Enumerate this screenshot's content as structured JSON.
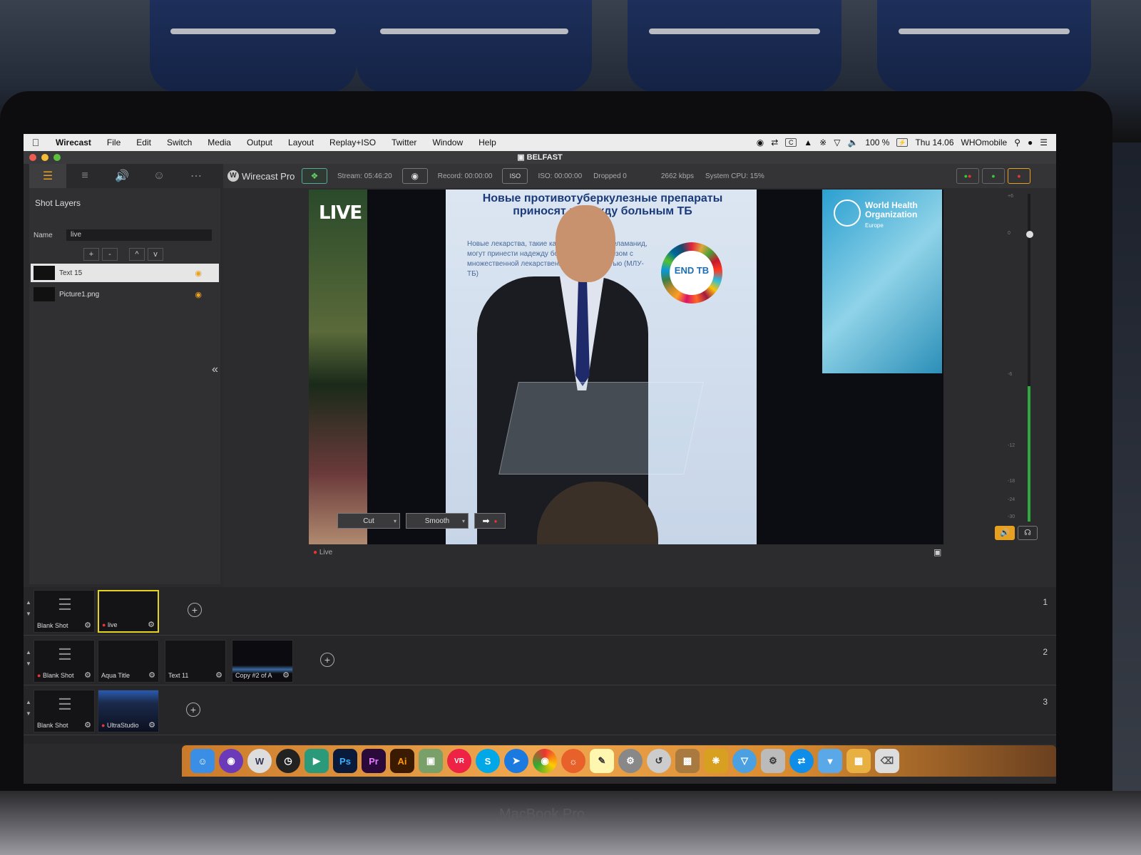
{
  "menubar": {
    "app_name": "Wirecast",
    "items": [
      "File",
      "Edit",
      "Switch",
      "Media",
      "Output",
      "Layout",
      "Replay+ISO",
      "Twitter",
      "Window",
      "Help"
    ],
    "battery": "100 %",
    "clock": "Thu 14.06",
    "user": "WHOmobile"
  },
  "window": {
    "title": "BELFAST"
  },
  "left_panel": {
    "title": "Shot Layers",
    "name_label": "Name",
    "name_value": "live",
    "buttons": [
      "+",
      "-",
      "^",
      "v"
    ],
    "layers": [
      {
        "name": "Text 15",
        "selected": true
      },
      {
        "name": "Picture1.png",
        "selected": false
      }
    ]
  },
  "toolbar": {
    "product": "Wirecast Pro",
    "stream": "Stream: 05:46:20",
    "record": "Record: 00:00:00",
    "iso_button": "ISO",
    "iso": "ISO: 00:00:00",
    "dropped": "Dropped 0",
    "bitrate": "2662 kbps",
    "cpu": "System CPU: 15%"
  },
  "preview": {
    "live_overlay": "LIVE",
    "banner_headline": "Новые противотуберкулезные препараты приносят надежду больным ТБ",
    "banner_body": "Новые лекарства, такие как бедаквилин и деламанид, могут принести надежду больным туберкулезом с множественной лекарственной устойчивостью (МЛУ-ТБ)",
    "endtb": "END TB",
    "slide_title": "World Health Organization",
    "slide_sub": "Europe",
    "live_label": "Live",
    "vu_ticks": [
      "+6",
      "0",
      "-6",
      "-12",
      "-18",
      "-24",
      "-30"
    ]
  },
  "transition": {
    "cut": "Cut",
    "smooth": "Smooth"
  },
  "shot_rows": [
    {
      "num": "1",
      "shots": [
        "Blank Shot",
        "live"
      ]
    },
    {
      "num": "2",
      "shots": [
        "Blank Shot",
        "Aqua Title",
        "Text 11",
        "Copy #2 of A"
      ]
    },
    {
      "num": "3",
      "shots": [
        "Blank Shot",
        "UltraStudio"
      ]
    }
  ],
  "dock": [
    "Finder",
    "Siri",
    "Wirecast",
    "Dashboard",
    "Keynote",
    "Ps",
    "Pr",
    "Ai",
    "Preview",
    "VR",
    "Skype",
    "Safari",
    "Chrome",
    "Firefox",
    "Notes",
    "System Preferences",
    "Migration",
    "Installer",
    "Pineapple",
    "Wi-Fi",
    "Disk Utility",
    "TeamViewer",
    "Downloads",
    "Archive",
    "Trash"
  ],
  "bezel_label": "MacBook Pro",
  "colors": {
    "accent": "#e8a021",
    "live_dot": "#e33333",
    "active_shot": "#e6d31e",
    "stream_on": "#66cc66"
  }
}
